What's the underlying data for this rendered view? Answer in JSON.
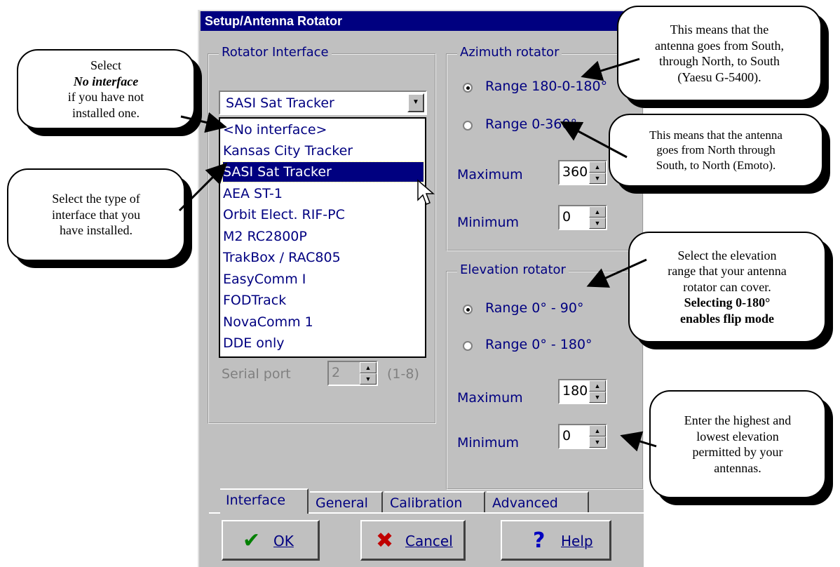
{
  "window": {
    "title": "Setup/Antenna Rotator"
  },
  "rotator_interface": {
    "title": "Rotator Interface",
    "selected": "SASI Sat Tracker",
    "options": [
      "<No interface>",
      "Kansas City Tracker",
      "SASI Sat Tracker",
      "AEA ST-1",
      "Orbit Elect. RIF-PC",
      "M2 RC2800P",
      "TrakBox / RAC805",
      "EasyComm I",
      "FODTrack",
      "NovaComm 1",
      "DDE only"
    ],
    "serial_port": {
      "label": "Serial port",
      "value": "2",
      "range": "(1-8)"
    }
  },
  "azimuth": {
    "title": "Azimuth rotator",
    "range1": "Range 180-0-180°",
    "range2": "Range 0-360°",
    "selected": "range1",
    "max_label": "Maximum",
    "max_value": "360",
    "min_label": "Minimum",
    "min_value": "0"
  },
  "elevation": {
    "title": "Elevation rotator",
    "range1": "Range 0° - 90°",
    "range2": "Range 0° - 180°",
    "selected": "range1",
    "max_label": "Maximum",
    "max_value": "180",
    "min_label": "Minimum",
    "min_value": "0"
  },
  "tabs": [
    "Interface",
    "General",
    "Calibration",
    "Advanced"
  ],
  "active_tab": "Interface",
  "buttons": {
    "ok": {
      "label": "OK",
      "icon": "checkmark-icon"
    },
    "cancel": {
      "label": "Cancel",
      "icon": "x-icon"
    },
    "help": {
      "label": "Help",
      "icon": "question-icon"
    }
  },
  "callouts": {
    "no_interface": {
      "pre": "Select ",
      "em": "No interface",
      "line2": "if you have not",
      "line3": "installed one."
    },
    "type": {
      "line1": "Select the type of",
      "line2": "interface that you",
      "line3": "have installed."
    },
    "south": {
      "line1": "This  means that the",
      "line2": "antenna goes from South,",
      "line3": "through North, to South",
      "line4": "(Yaesu G-5400)."
    },
    "north": {
      "line1": "This  means that the antenna",
      "line2": "goes from North through",
      "line3": "South, to North (Emoto)."
    },
    "elevation": {
      "line1": "Select the elevation",
      "line2": "range that your antenna",
      "line3": "rotator can cover.",
      "bold1": "Selecting 0-180°",
      "bold2": "enables flip mode"
    },
    "minmax": {
      "line1": "Enter the highest and",
      "line2": "lowest elevation",
      "line3": "permitted by your",
      "line4": "antennas."
    }
  }
}
